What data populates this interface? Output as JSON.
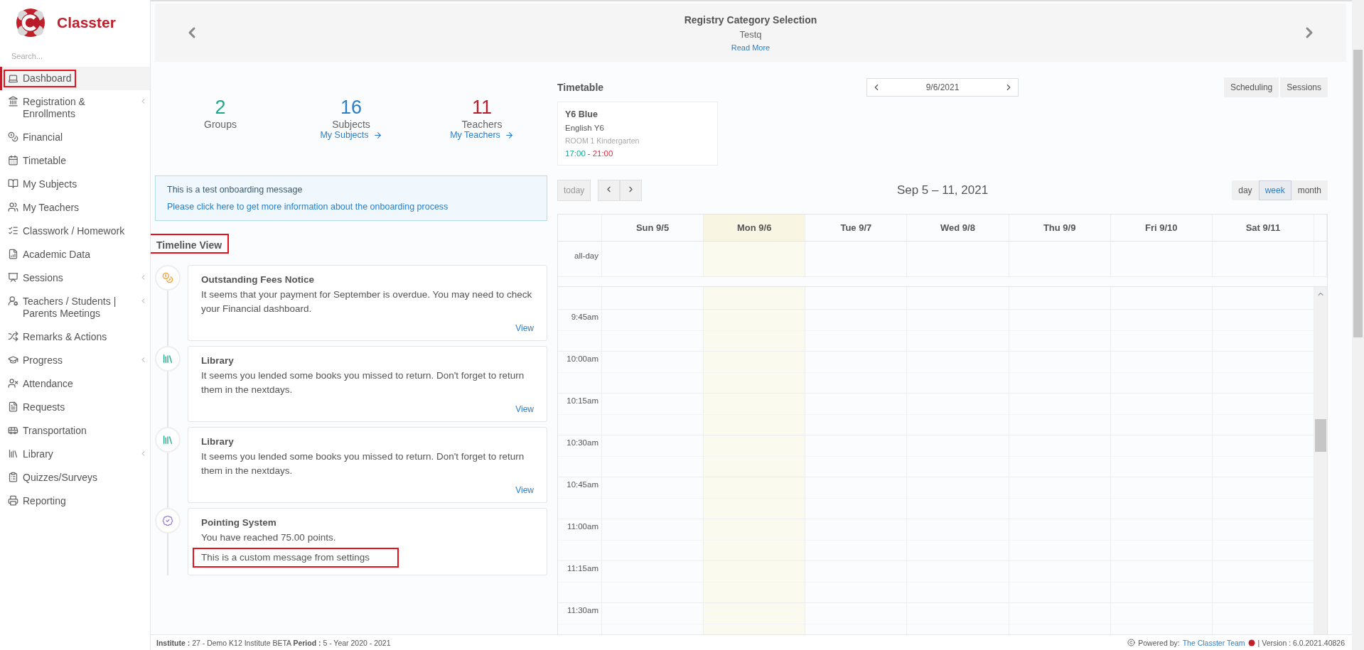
{
  "sidebar": {
    "brand": "Classter",
    "search": {
      "placeholder": "Search..."
    },
    "items": [
      {
        "label": "Dashboard",
        "selected": true,
        "expandable": false,
        "annotated": true
      },
      {
        "label": "Registration & Enrollments",
        "selected": false,
        "expandable": true,
        "annotated": false
      },
      {
        "label": "Financial",
        "selected": false,
        "expandable": false,
        "annotated": false
      },
      {
        "label": "Timetable",
        "selected": false,
        "expandable": false,
        "annotated": false
      },
      {
        "label": "My Subjects",
        "selected": false,
        "expandable": false,
        "annotated": false
      },
      {
        "label": "My Teachers",
        "selected": false,
        "expandable": false,
        "annotated": false
      },
      {
        "label": "Classwork / Homework",
        "selected": false,
        "expandable": false,
        "annotated": false
      },
      {
        "label": "Academic Data",
        "selected": false,
        "expandable": false,
        "annotated": false
      },
      {
        "label": "Sessions",
        "selected": false,
        "expandable": true,
        "annotated": false
      },
      {
        "label": "Teachers / Students | Parents Meetings",
        "selected": false,
        "expandable": true,
        "annotated": false
      },
      {
        "label": "Remarks & Actions",
        "selected": false,
        "expandable": false,
        "annotated": false
      },
      {
        "label": "Progress",
        "selected": false,
        "expandable": true,
        "annotated": false
      },
      {
        "label": "Attendance",
        "selected": false,
        "expandable": false,
        "annotated": false
      },
      {
        "label": "Requests",
        "selected": false,
        "expandable": false,
        "annotated": false
      },
      {
        "label": "Transportation",
        "selected": false,
        "expandable": false,
        "annotated": false
      },
      {
        "label": "Library",
        "selected": false,
        "expandable": true,
        "annotated": false
      },
      {
        "label": "Quizzes/Surveys",
        "selected": false,
        "expandable": false,
        "annotated": false
      },
      {
        "label": "Reporting",
        "selected": false,
        "expandable": false,
        "annotated": false
      }
    ]
  },
  "banner": {
    "title": "Registry Category Selection",
    "subtitle": "Testq",
    "link": "Read More"
  },
  "stats": [
    {
      "value": "2",
      "label": "Groups",
      "color": "#1aaa8a"
    },
    {
      "value": "16",
      "label": "Subjects",
      "link": "My Subjects",
      "color": "#2a7fc8"
    },
    {
      "value": "11",
      "label": "Teachers",
      "link": "My Teachers",
      "color": "#b5202c"
    }
  ],
  "onboarding": {
    "message": "This is a test onboarding message",
    "link": "Please click here to get more information about the onboarding process"
  },
  "timeline": {
    "title": "Timeline View",
    "annotated": true,
    "entries": [
      {
        "kind": "fees",
        "title": "Outstanding Fees Notice",
        "text": "It seems that your payment for September is overdue. You may need to check your Financial dashboard.",
        "link": "View"
      },
      {
        "kind": "library",
        "title": "Library",
        "text": "It seems you lended some books you missed to return. Don't forget to return them in the nextdays.",
        "link": "View"
      },
      {
        "kind": "library",
        "title": "Library",
        "text": "It seems you lended some books you missed to return. Don't forget to return them in the nextdays.",
        "link": "View"
      },
      {
        "kind": "points",
        "title": "Pointing System",
        "text": "You have reached 75.00 points.",
        "note": "This is a custom message from settings",
        "note_annotated": true
      }
    ]
  },
  "timetable": {
    "title": "Timetable",
    "date": "9/6/2021",
    "buttons": [
      "Scheduling",
      "Sessions"
    ],
    "event": {
      "group": "Y6 Blue",
      "subject": "English Y6",
      "room": "ROOM 1 Kindergarten",
      "start": "17:00",
      "separator": "-",
      "end": "21:00"
    }
  },
  "calendar": {
    "today": "today",
    "range": "Sep 5 – 11, 2021",
    "views": [
      {
        "label": "day",
        "selected": false
      },
      {
        "label": "week",
        "selected": true
      },
      {
        "label": "month",
        "selected": false
      }
    ],
    "days": [
      {
        "label": "Sun 9/5",
        "today": false
      },
      {
        "label": "Mon 9/6",
        "today": true
      },
      {
        "label": "Tue 9/7",
        "today": false
      },
      {
        "label": "Wed 9/8",
        "today": false
      },
      {
        "label": "Thu 9/9",
        "today": false
      },
      {
        "label": "Fri 9/10",
        "today": false
      },
      {
        "label": "Sat 9/11",
        "today": false
      }
    ],
    "allday": "all-day",
    "times": [
      "9:45am",
      "10:00am",
      "10:15am",
      "10:30am",
      "10:45am",
      "11:00am",
      "11:15am",
      "11:30am"
    ]
  },
  "footer": {
    "info": "**Institute :** 27 - Demo K12 Institute BETA **Period :** 5 - Year 2020 - 2021",
    "powered": "Powered by:",
    "team": "The Classter Team",
    "version": "| Version : 6.0.2021.40826"
  }
}
